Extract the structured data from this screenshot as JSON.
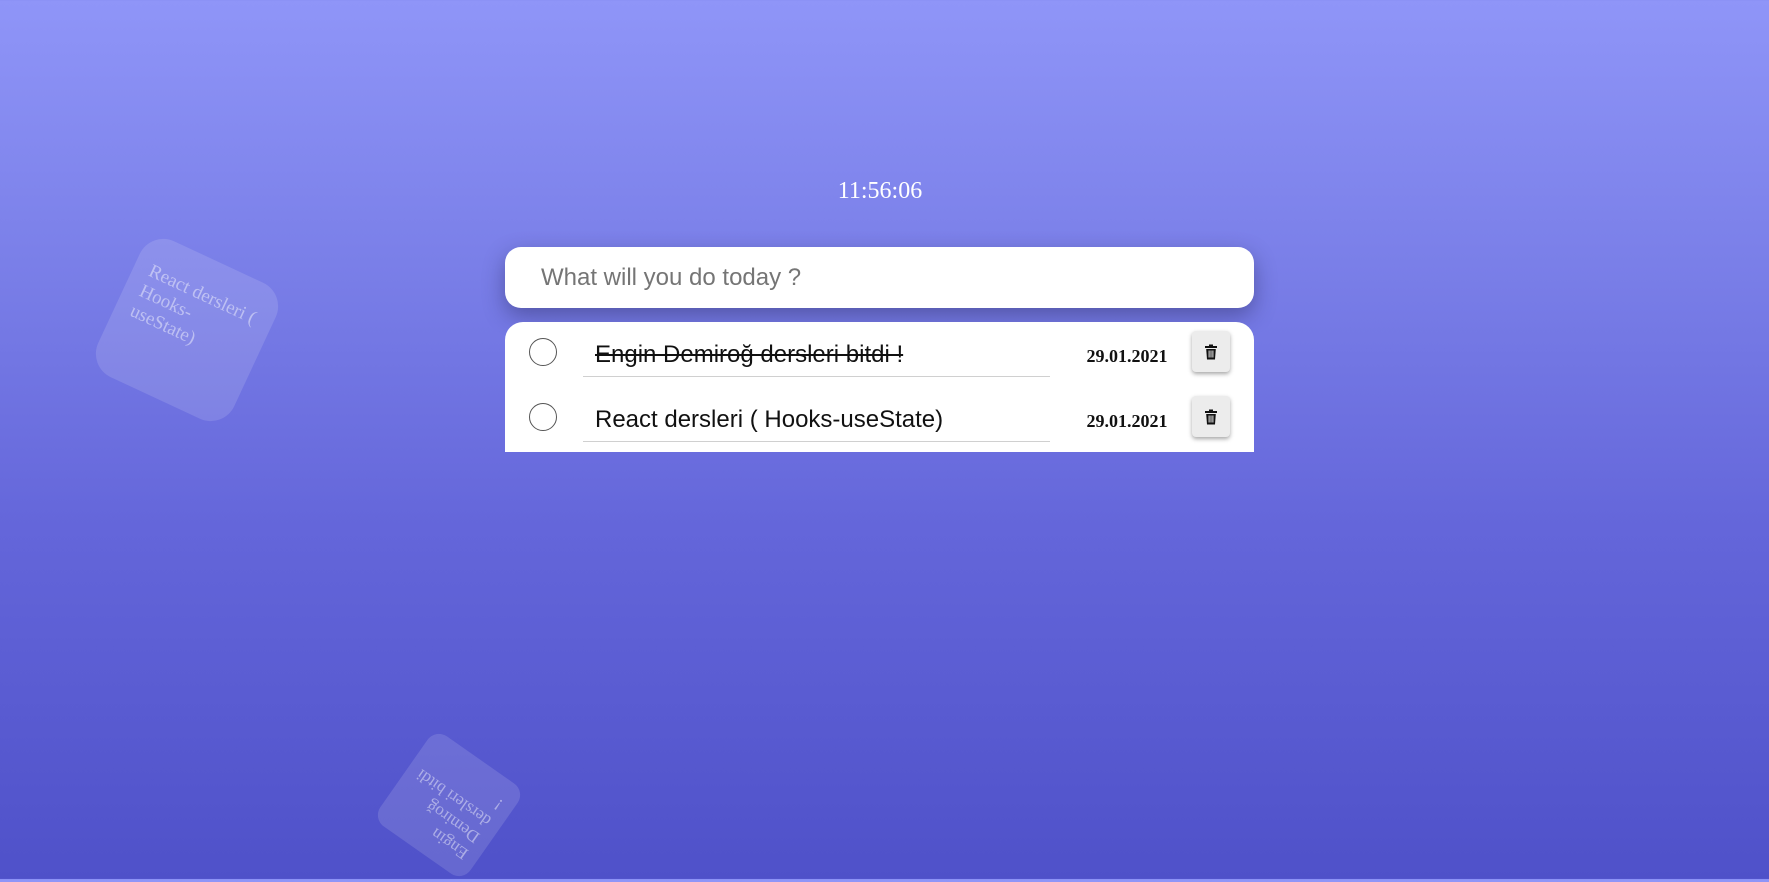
{
  "clock": {
    "time": "11:56:06"
  },
  "input": {
    "placeholder": "What will you do today ?"
  },
  "tasks": [
    {
      "text": "Engin Demiroğ dersleri bitdi !",
      "date": "29.01.2021",
      "completed": true
    },
    {
      "text": "React dersleri ( Hooks-useState)",
      "date": "29.01.2021",
      "completed": false
    }
  ],
  "notes": [
    {
      "text": "React dersleri ( Hooks-useState)"
    },
    {
      "text": "Engin Demiroğ dersleri bitdi !"
    }
  ],
  "icons": {
    "delete": "trash-icon"
  },
  "colors": {
    "background_top": "#8f95f8",
    "background_bottom": "#4f51c9"
  }
}
